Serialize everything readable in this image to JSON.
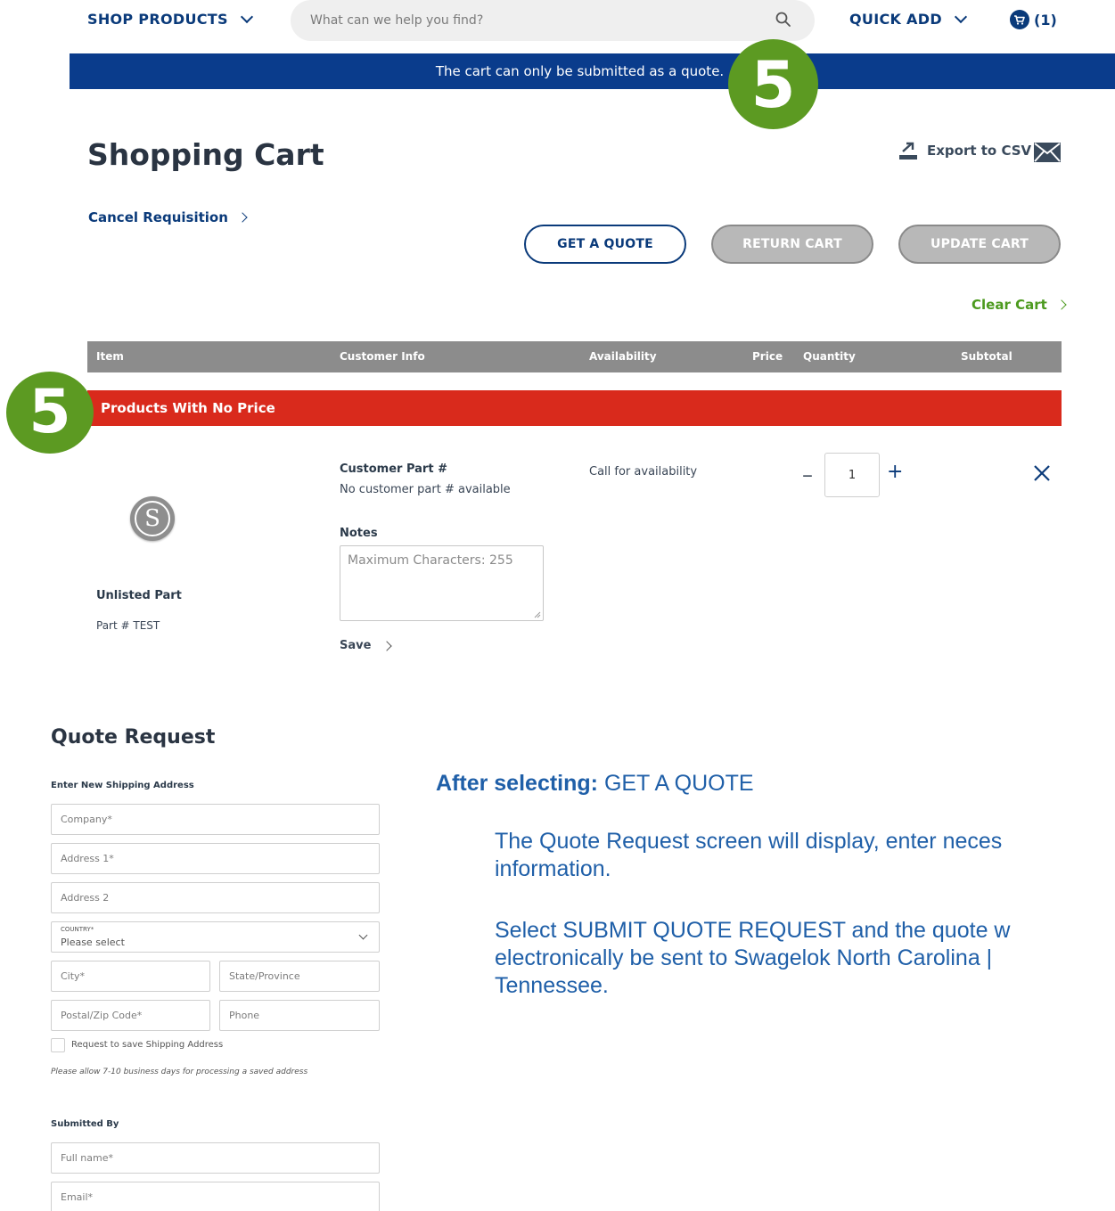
{
  "header": {
    "shop_products": "SHOP PRODUCTS",
    "search_placeholder": "What can we help you find?",
    "quick_add": "QUICK ADD",
    "cart_count": "(1)"
  },
  "banner": {
    "message": "The cart can only be submitted as a quote."
  },
  "callout": {
    "number": "5"
  },
  "page": {
    "title": "Shopping Cart",
    "export_label": "Export to CSV",
    "cancel_requisition": "Cancel Requisition",
    "clear_cart": "Clear Cart"
  },
  "actions": {
    "get_quote": "GET A QUOTE",
    "return_cart": "RETURN CART",
    "update_cart": "UPDATE CART"
  },
  "table": {
    "headers": [
      "Item",
      "Customer Info",
      "Availability",
      "Price",
      "Quantity",
      "Subtotal"
    ],
    "group_label": "Products With No Price",
    "row": {
      "item_name": "Unlisted Part",
      "part_number": "Part # TEST",
      "customer_part_label": "Customer Part #",
      "customer_part_value": "No customer part # available",
      "notes_label": "Notes",
      "notes_placeholder": "Maximum Characters: 255",
      "save_label": "Save",
      "availability": "Call for availability",
      "quantity": "1",
      "logo_letter": "S"
    }
  },
  "quote_request": {
    "title": "Quote Request",
    "shipping_heading": "Enter New Shipping Address",
    "company": "Company*",
    "address1": "Address 1*",
    "address2": "Address 2",
    "country_label": "COUNTRY*",
    "country_value": "Please select",
    "city": "City*",
    "state": "State/Province",
    "postal": "Postal/Zip Code*",
    "phone": "Phone",
    "save_address_label": "Request to save Shipping Address",
    "processing_note": "Please allow 7-10 business days for processing a saved address",
    "submitted_heading": "Submitted By",
    "full_name": "Full name*",
    "email": "Email*"
  },
  "instructions": {
    "lead": "After selecting:",
    "lead_action": "GET A QUOTE",
    "para1": "The Quote Request screen will display, enter neces information.",
    "para2": "Select SUBMIT QUOTE REQUEST and the quote w electronically be sent to Swagelok North Carolina | Tennessee."
  },
  "colors": {
    "brand_blue": "#0a3a7a",
    "banner_blue": "#0a3c8c",
    "alert_red": "#d92a1c",
    "callout_green": "#5c9a22",
    "link_green": "#4c9a1e",
    "instruction_blue": "#1f5fa8"
  }
}
